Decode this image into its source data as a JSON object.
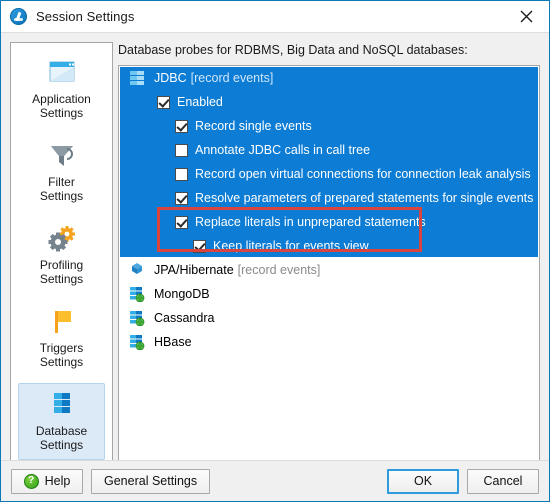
{
  "window": {
    "title": "Session Settings",
    "app_icon": "session-settings-app-icon",
    "close_icon": "close-icon"
  },
  "sidebar": {
    "items": [
      {
        "label_line1": "Application",
        "label_line2": "Settings",
        "icon": "application-window-icon",
        "selected": false
      },
      {
        "label_line1": "Filter",
        "label_line2": "Settings",
        "icon": "funnel-filter-icon",
        "selected": false
      },
      {
        "label_line1": "Profiling",
        "label_line2": "Settings",
        "icon": "gears-profiling-icon",
        "selected": false
      },
      {
        "label_line1": "Triggers",
        "label_line2": "Settings",
        "icon": "flag-triggers-icon",
        "selected": false
      },
      {
        "label_line1": "Database",
        "label_line2": "Settings",
        "icon": "database-stack-icon",
        "selected": true
      }
    ],
    "scroll_down_icon": "chevron-down-icon"
  },
  "pane": {
    "caption": "Database probes for RDBMS, Big Data and NoSQL databases:",
    "rows": [
      {
        "label": "JDBC",
        "suffix": "[record events]",
        "kind": "node",
        "icon": "database-stack-icon",
        "indent": 1,
        "checked": null,
        "on_blue": true
      },
      {
        "label": "Enabled",
        "suffix": "",
        "kind": "checkbox",
        "icon": "",
        "indent": 2,
        "checked": true,
        "on_blue": true
      },
      {
        "label": "Record single events",
        "suffix": "",
        "kind": "checkbox",
        "icon": "",
        "indent": 3,
        "checked": true,
        "on_blue": true
      },
      {
        "label": "Annotate JDBC calls in call tree",
        "suffix": "",
        "kind": "checkbox",
        "icon": "",
        "indent": 3,
        "checked": false,
        "on_blue": true
      },
      {
        "label": "Record open virtual connections for connection leak analysis",
        "suffix": "",
        "kind": "checkbox",
        "icon": "",
        "indent": 3,
        "checked": false,
        "on_blue": true
      },
      {
        "label": "Resolve parameters of prepared statements for single events",
        "suffix": "",
        "kind": "checkbox",
        "icon": "",
        "indent": 3,
        "checked": true,
        "on_blue": true
      },
      {
        "label": "Replace literals in unprepared statements",
        "suffix": "",
        "kind": "checkbox",
        "icon": "",
        "indent": 3,
        "checked": true,
        "on_blue": true
      },
      {
        "label": "Keep literals for events view",
        "suffix": "",
        "kind": "checkbox",
        "icon": "",
        "indent": 4,
        "checked": true,
        "on_blue": true
      },
      {
        "label": "JPA/Hibernate",
        "suffix": "[record events]",
        "kind": "node",
        "icon": "hibernate-cubes-icon",
        "indent": 1,
        "checked": null,
        "on_blue": false
      },
      {
        "label": "MongoDB",
        "suffix": "",
        "kind": "node",
        "icon": "database-globe-icon",
        "indent": 1,
        "checked": null,
        "on_blue": false
      },
      {
        "label": "Cassandra",
        "suffix": "",
        "kind": "node",
        "icon": "database-globe-icon",
        "indent": 1,
        "checked": null,
        "on_blue": false
      },
      {
        "label": "HBase",
        "suffix": "",
        "kind": "node",
        "icon": "database-globe-icon",
        "indent": 1,
        "checked": null,
        "on_blue": false
      }
    ],
    "highlight_color": "#d9443f"
  },
  "footer": {
    "help_label": "Help",
    "help_icon": "question-mark-icon",
    "general_settings_label": "General Settings",
    "ok_label": "OK",
    "cancel_label": "Cancel"
  },
  "colors": {
    "selection_blue": "#0c7cd5",
    "accent_border": "#0a79b8",
    "focus_blue": "#2e9bdc",
    "highlight_red": "#d9443f"
  }
}
